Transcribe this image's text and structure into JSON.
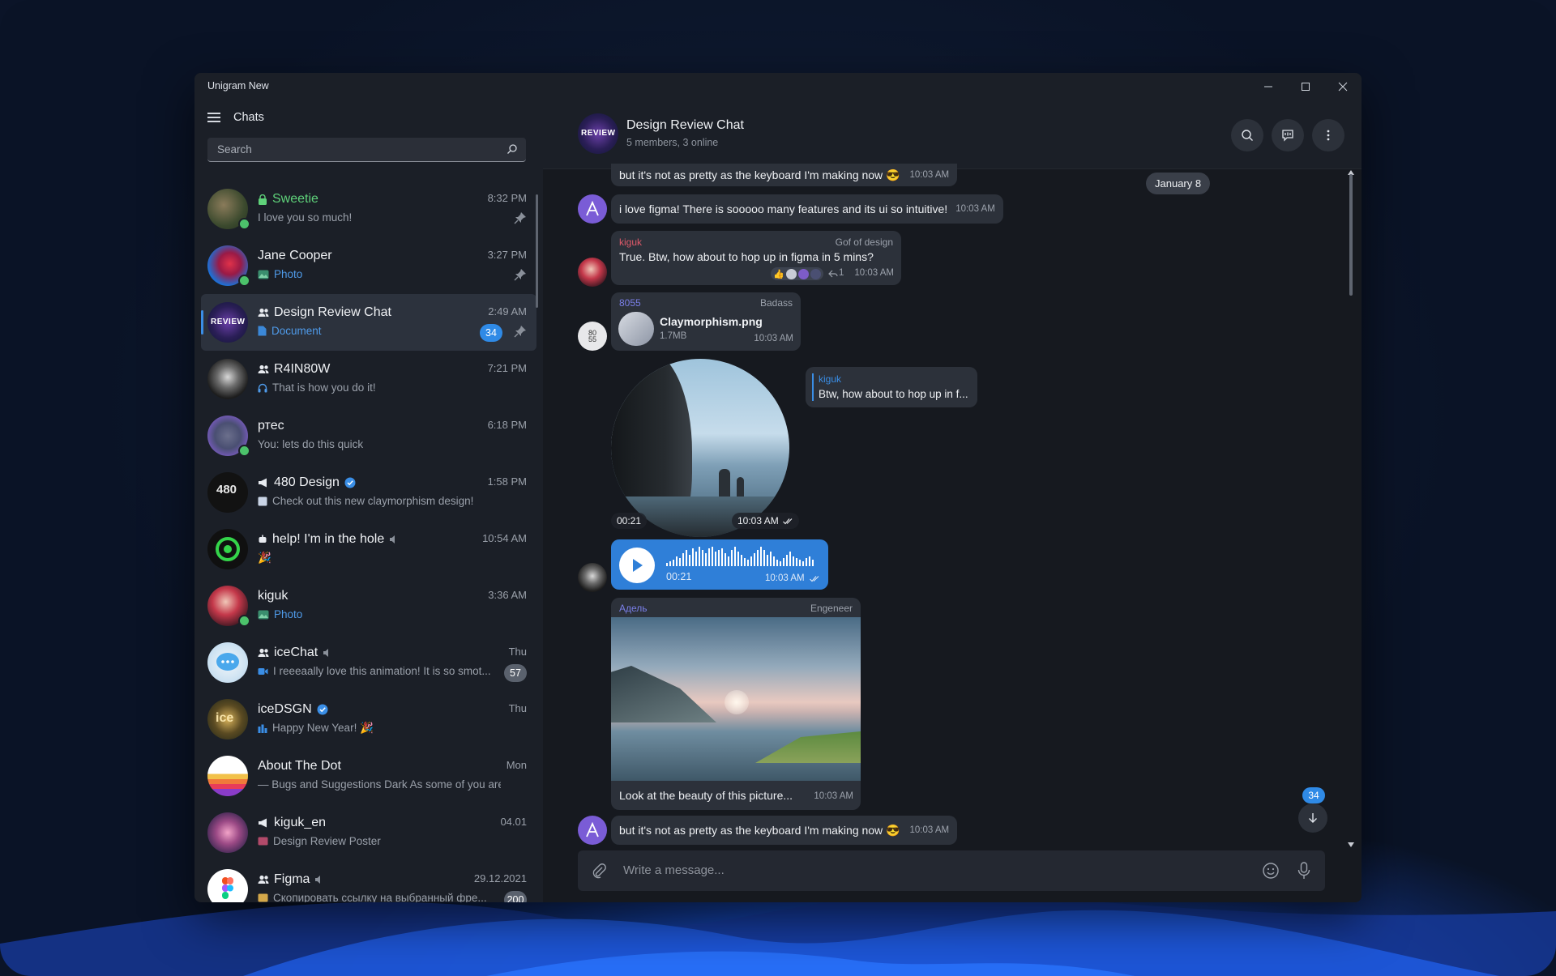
{
  "window": {
    "title": "Unigram New"
  },
  "sidebar": {
    "title": "Chats",
    "search_placeholder": "Search",
    "chats": [
      {
        "name": "Sweetie",
        "preview": "I love you so much!",
        "time": "8:32 PM",
        "pinned": true,
        "online": true,
        "locked": true
      },
      {
        "name": "Jane Cooper",
        "preview": "Photo",
        "time": "3:27 PM",
        "pinned": true,
        "online": true
      },
      {
        "name": "Design Review Chat",
        "preview": "Document",
        "time": "2:49 AM",
        "unread": "34",
        "pinned": true,
        "active": true,
        "group": true
      },
      {
        "name": "R4IN80W",
        "preview": "That is how you do it!",
        "time": "7:21 PM",
        "group": true
      },
      {
        "name": "ртес",
        "preview": "You: lets do this quick",
        "time": "6:18 PM",
        "online": true
      },
      {
        "name": "480 Design",
        "preview": "Check out this new claymorphism design!",
        "time": "1:58 PM",
        "channel": true,
        "verified": true
      },
      {
        "name": "help! I'm in the hole",
        "preview": "🎉",
        "time": "10:54 AM",
        "muted": true,
        "bot": true
      },
      {
        "name": "kiguk",
        "preview": "Photo",
        "time": "3:36 AM",
        "online": true
      },
      {
        "name": "iceChat",
        "preview": "I reeeaally love this animation! It is so smot...",
        "time": "Thu",
        "unread": "57",
        "muted": true,
        "group": true
      },
      {
        "name": "iceDSGN",
        "preview": "Happy New Year! 🎉",
        "time": "Thu",
        "verified": true
      },
      {
        "name": "About The Dot",
        "preview": "— Bugs and Suggestions Dark As some of you are ...",
        "time": "Mon"
      },
      {
        "name": "kiguk_en",
        "preview": "Design Review Poster",
        "time": "04.01",
        "channel": true
      },
      {
        "name": "Figma",
        "preview": "Скопировать ссылку на выбранный фре...",
        "time": "29.12.2021",
        "unread": "200",
        "muted": true,
        "group": true
      }
    ]
  },
  "chat": {
    "title": "Design Review Chat",
    "subtitle": "5 members, 3 online",
    "date_chip": "January 8",
    "messages": {
      "m1": {
        "text": "but it's not as pretty as the keyboard I'm making now 😎",
        "time": "10:03 AM"
      },
      "m2": {
        "text": "i love figma! There is sooooo many features and its ui so intuitive!",
        "time": "10:03 AM"
      },
      "m3": {
        "sender": "kiguk",
        "title": "Gof of design",
        "text": "True. Btw, how about to hop up in figma in 5 mins?",
        "reply_count": "1",
        "time": "10:03 AM"
      },
      "m4": {
        "sender": "8055",
        "title": "Badass",
        "file_name": "Claymorphism.png",
        "file_size": "1.7MB",
        "time": "10:03 AM",
        "avatar_text": "80 55"
      },
      "m5": {
        "duration": "00:21",
        "time": "10:03 AM",
        "reply_sender": "kiguk",
        "reply_text": "Btw, how about to hop up in f..."
      },
      "m6": {
        "duration": "00:21",
        "time": "10:03 AM"
      },
      "m7": {
        "sender": "Адель",
        "title": "Engeneer",
        "caption": "Look at the beauty of this picture...",
        "time": "10:03 AM"
      },
      "m8": {
        "text": "but it's not as pretty as the keyboard I'm making now 😎",
        "time": "10:03 AM"
      }
    },
    "scroll_unread": "34",
    "composer_placeholder": "Write a message..."
  },
  "colors": {
    "accent": "#2f8ae6",
    "background": "#16191f",
    "bubble": "#2c313a",
    "online": "#4cc26b"
  }
}
